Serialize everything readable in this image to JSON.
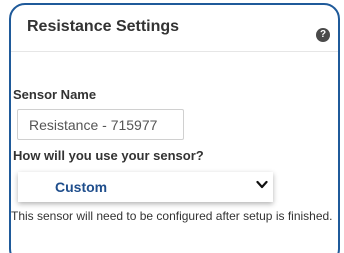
{
  "panel": {
    "title": "Resistance Settings",
    "help_icon": "help-icon",
    "help_glyph": "?"
  },
  "sensor_name": {
    "label": "Sensor Name",
    "value": "Resistance - 715977"
  },
  "usage": {
    "label": "How will you use your sensor?",
    "selected": "Custom",
    "chevron_icon": "chevron-down-icon"
  },
  "note": "This sensor will need to be configured after setup is finished.",
  "colors": {
    "panel_border": "#1f5a9a",
    "select_text": "#1f4e8c"
  }
}
